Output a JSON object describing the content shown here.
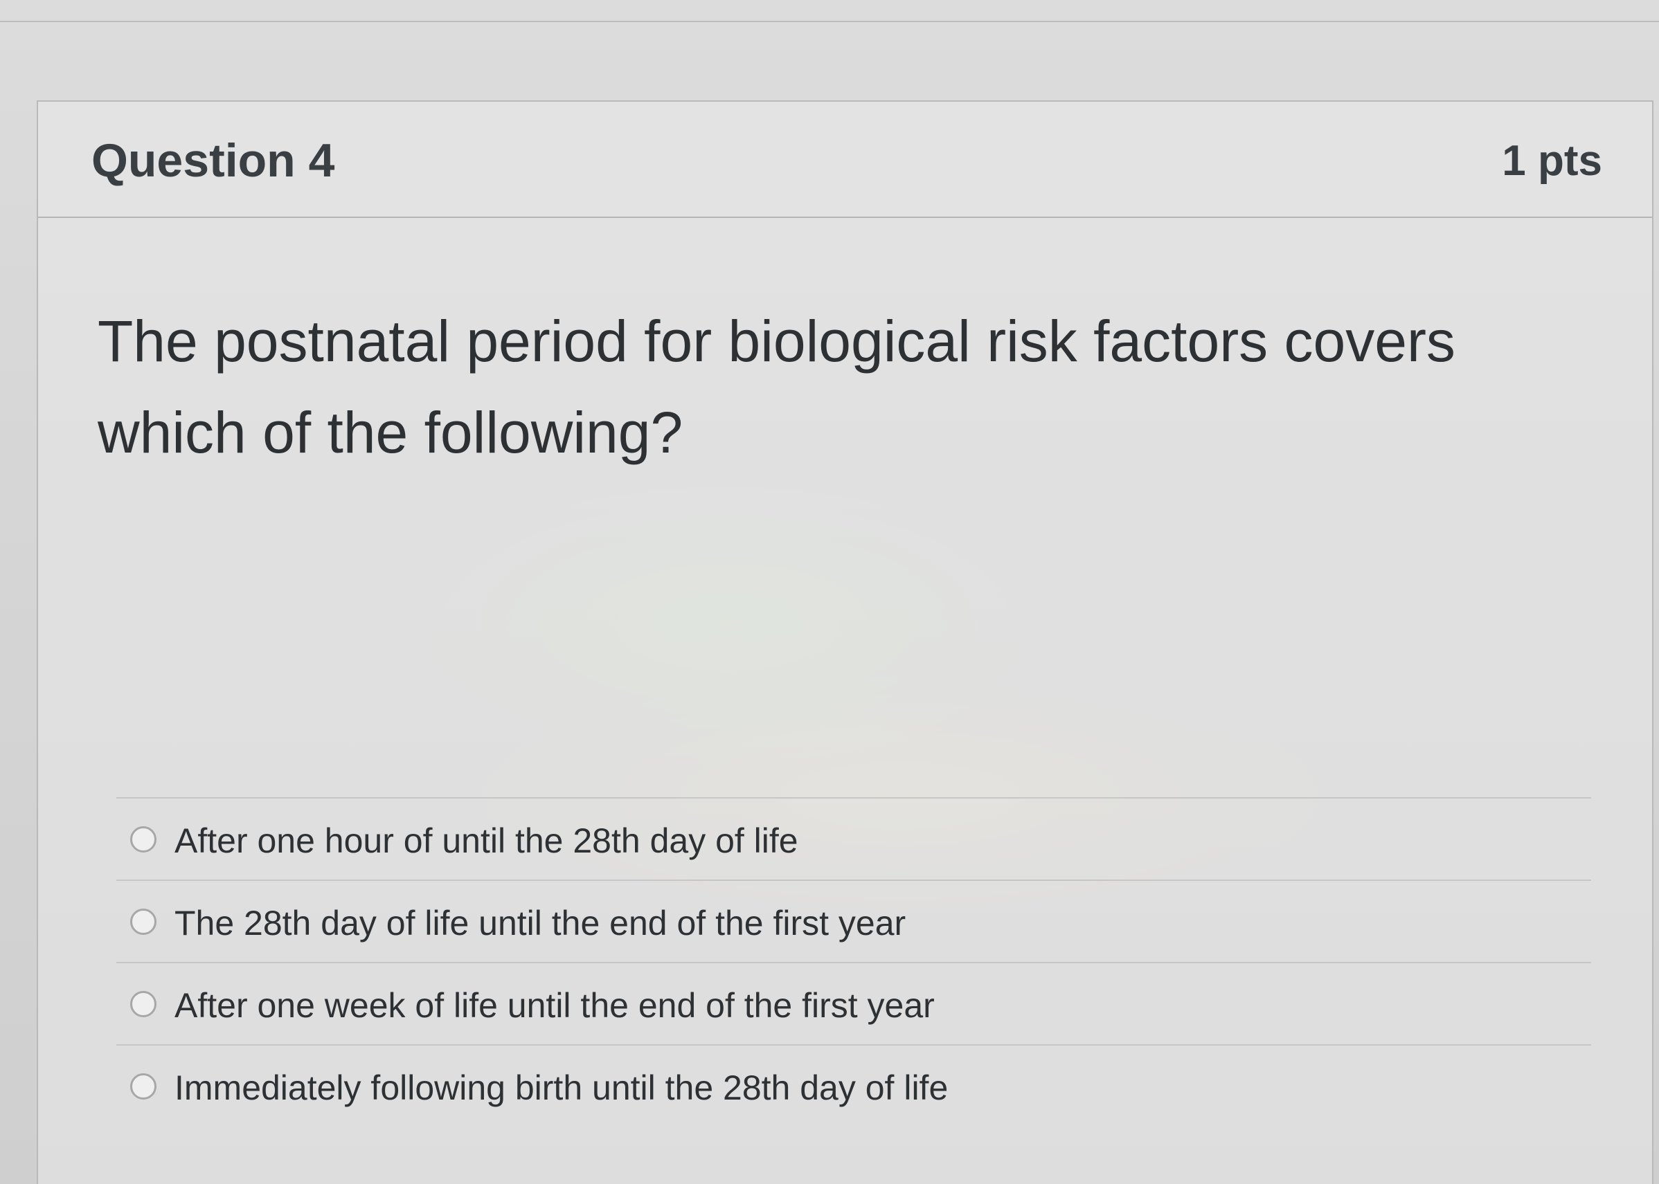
{
  "question": {
    "title": "Question 4",
    "points": "1 pts",
    "text": "The postnatal period for biological risk factors covers which of the following?",
    "answers": [
      {
        "label": "After one hour of until the 28th day of life",
        "selected": false
      },
      {
        "label": "The 28th day of life until the end of the first year",
        "selected": false
      },
      {
        "label": "After one week of life until the end of the first year",
        "selected": false
      },
      {
        "label": "Immediately following birth until the 28th day of life",
        "selected": false
      }
    ]
  },
  "colors": {
    "text": "#2e3134",
    "header_bg": "#e3e3e3",
    "border": "#b9b9b9"
  }
}
